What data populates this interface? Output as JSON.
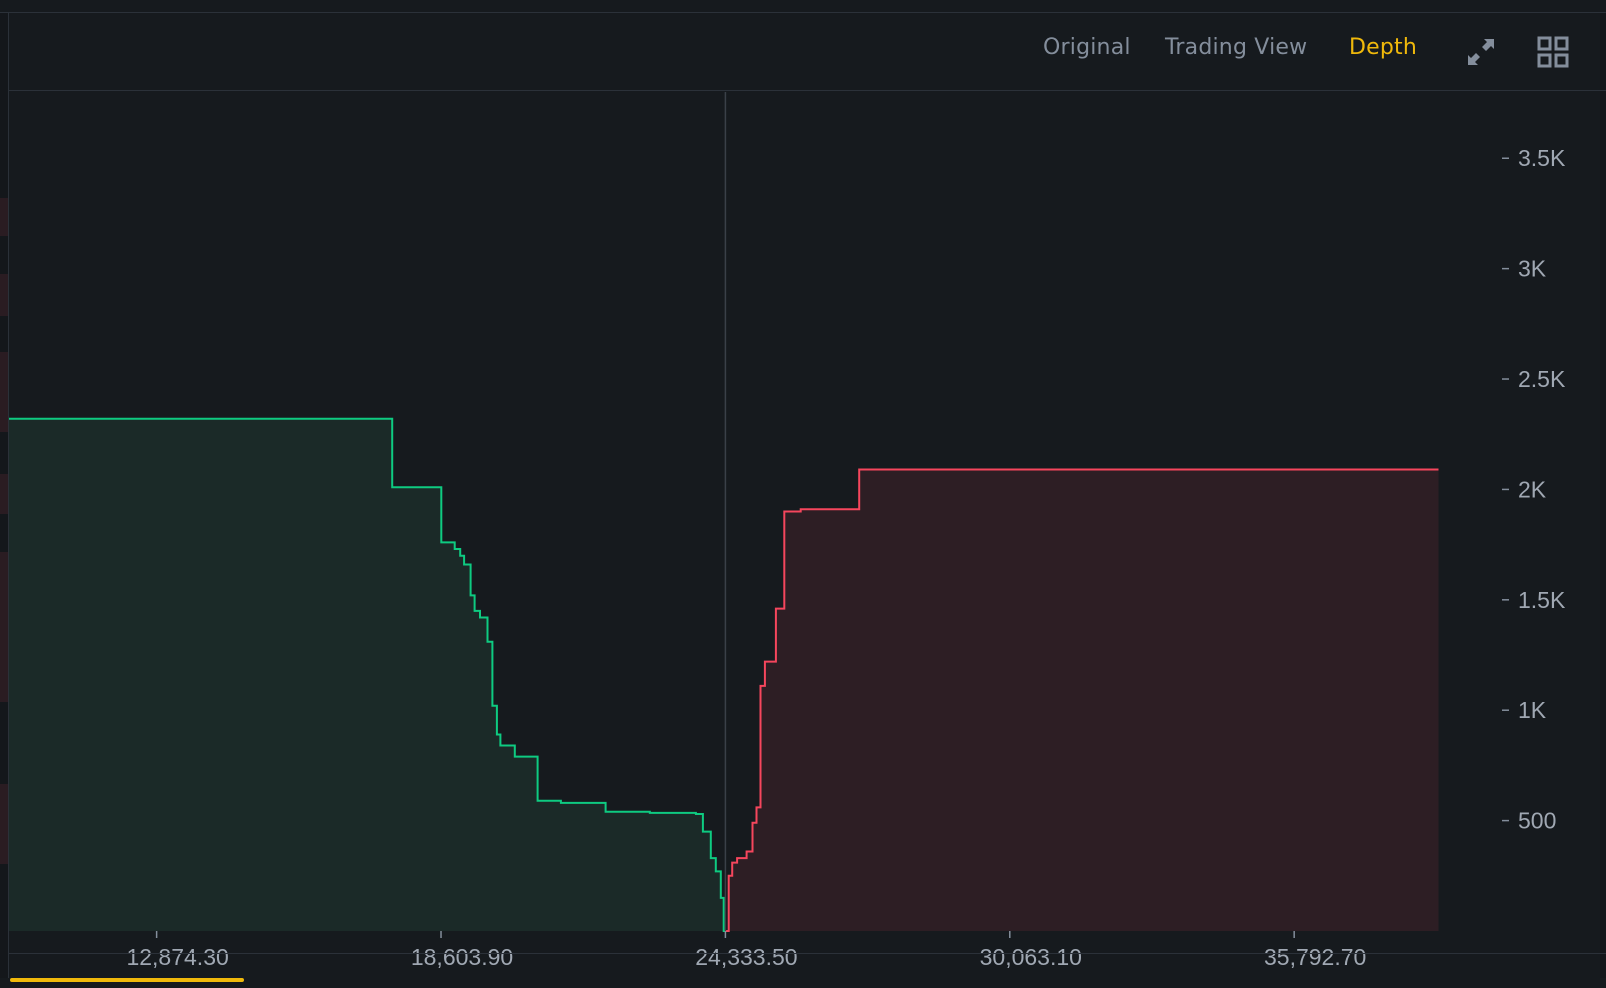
{
  "toolbar": {
    "tabs": [
      {
        "label": "Original",
        "active": false
      },
      {
        "label": "Trading View",
        "active": false
      },
      {
        "label": "Depth",
        "active": true
      }
    ],
    "icons": [
      "expand-icon",
      "grid-layout-icon"
    ]
  },
  "colors": {
    "background": "#161a1e",
    "border": "#2b3139",
    "bid_line": "#0ecb81",
    "bid_fill": "#1b2a28",
    "ask_line": "#f6465d",
    "ask_fill": "#2d1e24",
    "text_muted": "#848e9c",
    "active_tab": "#f0b90b",
    "axis_text": "#a0a8b3"
  },
  "chart_data": {
    "type": "area",
    "chart_kind": "order-book depth",
    "xlim": [
      9900,
      40000
    ],
    "ylim": [
      0,
      3800
    ],
    "x_ticks": [
      {
        "value": 12874.3,
        "label": "12,874.30"
      },
      {
        "value": 18603.9,
        "label": "18,603.90"
      },
      {
        "value": 24333.5,
        "label": "24,333.50"
      },
      {
        "value": 30063.1,
        "label": "30,063.10"
      },
      {
        "value": 35792.7,
        "label": "35,792.70"
      }
    ],
    "y_ticks": [
      {
        "value": 500,
        "label": "500"
      },
      {
        "value": 1000,
        "label": "1K"
      },
      {
        "value": 1500,
        "label": "1.5K"
      },
      {
        "value": 2000,
        "label": "2K"
      },
      {
        "value": 2500,
        "label": "2.5K"
      },
      {
        "value": 3000,
        "label": "3K"
      },
      {
        "value": 3500,
        "label": "3.5K"
      }
    ],
    "mid_price": 24333.5,
    "series": [
      {
        "side": "bids",
        "steps": [
          [
            24333.5,
            0
          ],
          [
            24300,
            150
          ],
          [
            24240,
            270
          ],
          [
            24140,
            330
          ],
          [
            24040,
            450
          ],
          [
            23880,
            530
          ],
          [
            23740,
            535
          ],
          [
            22810,
            540
          ],
          [
            21920,
            580
          ],
          [
            21020,
            590
          ],
          [
            20550,
            790
          ],
          [
            20090,
            840
          ],
          [
            19800,
            890
          ],
          [
            19730,
            1020
          ],
          [
            19640,
            1310
          ],
          [
            19540,
            1420
          ],
          [
            19390,
            1450
          ],
          [
            19280,
            1520
          ],
          [
            19200,
            1660
          ],
          [
            19070,
            1700
          ],
          [
            18990,
            1730
          ],
          [
            18880,
            1760
          ],
          [
            18610,
            2010
          ],
          [
            17620,
            2320
          ],
          [
            9900,
            2320
          ]
        ]
      },
      {
        "side": "asks",
        "steps": [
          [
            24333.5,
            0
          ],
          [
            24400,
            250
          ],
          [
            24470,
            310
          ],
          [
            24570,
            330
          ],
          [
            24760,
            360
          ],
          [
            24880,
            490
          ],
          [
            24960,
            560
          ],
          [
            25040,
            1110
          ],
          [
            25130,
            1220
          ],
          [
            25350,
            1460
          ],
          [
            25520,
            1900
          ],
          [
            25850,
            1910
          ],
          [
            26200,
            1910
          ],
          [
            27020,
            1910
          ],
          [
            27030,
            2090
          ],
          [
            38700,
            2090
          ]
        ]
      }
    ]
  }
}
